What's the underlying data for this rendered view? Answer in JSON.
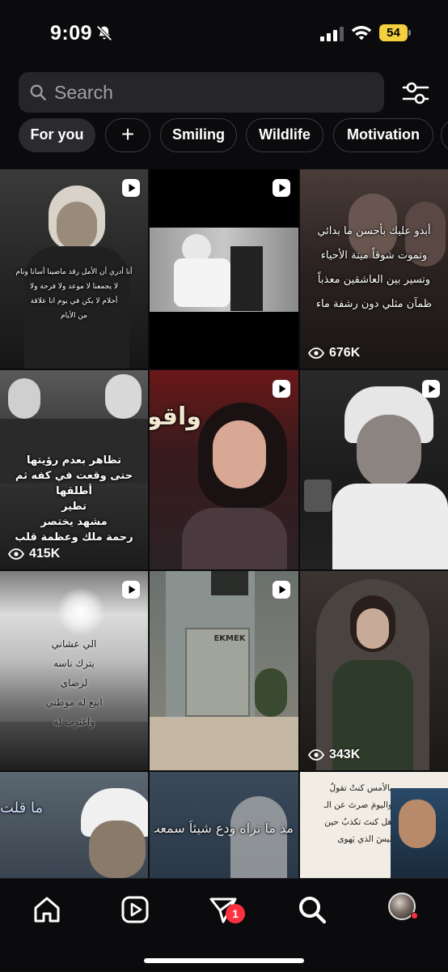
{
  "status_bar": {
    "time": "9:09",
    "battery_level": "54",
    "icons": [
      "bell-slash-icon",
      "signal-icon",
      "wifi-icon",
      "battery-icon"
    ]
  },
  "search": {
    "placeholder": "Search",
    "value": ""
  },
  "chips": [
    {
      "label": "For you",
      "active": true
    },
    {
      "label": "+",
      "active": false
    },
    {
      "label": "Smiling",
      "active": false
    },
    {
      "label": "Wildlife",
      "active": false
    },
    {
      "label": "Motivation",
      "active": false
    }
  ],
  "grid": {
    "tiles": [
      {
        "caption": "أنا أدري أن الأمل رقد ماضينا أسانا ونام\nلا يجمعنا لا موعد ولا فرحة ولا\nأحلام لا يكن في يوم انا علاقة\nمن الأيام",
        "reel": true,
        "views": ""
      },
      {
        "caption": "",
        "reel": true,
        "views": ""
      },
      {
        "caption": "أبدو عليك بأحسن ما بدائي\nوتموت شوقاً ميتة الأحياء\nوتسير بين العاشقين معذباً\nظمآن مثلي دون رشفة ماء",
        "reel": false,
        "views": "676K"
      },
      {
        "caption": "تظاهر بعدم رؤيتها\nحتى وقعت في كفه ثم أطلقها\nتطير\nمشهد يختصر\nرحمة ملك وعظمة قلب",
        "reel": false,
        "views": "415K"
      },
      {
        "caption": "واقو",
        "reel": true,
        "views": ""
      },
      {
        "caption": "",
        "reel": true,
        "views": ""
      },
      {
        "caption": "الي عشاني\nيترك ناسه\nلرضاي\nابيع له موطني\nواغترب له",
        "reel": true,
        "views": ""
      },
      {
        "caption": "EKMEK",
        "reel": true,
        "views": ""
      },
      {
        "caption": "",
        "reel": false,
        "views": "343K"
      },
      {
        "caption": "ما قلت",
        "reel": false,
        "views": ""
      },
      {
        "caption": "مذ ما تراه ودع شيئاً سمعت به",
        "reel": false,
        "views": ""
      },
      {
        "caption": "بالأمس كنتُ تقولُ\nواليومَ صرتَ عن الـ\nهل كنتَ تكذبُ حين\nليسَ الذي يَهوى",
        "reel": false,
        "views": ""
      }
    ]
  },
  "nav": {
    "items": [
      "home-icon",
      "reels-icon",
      "send-icon",
      "search-icon",
      "profile-avatar"
    ],
    "messages_badge": "1"
  },
  "colors": {
    "background": "#0b0b0d",
    "chip_active": "#2a2a2f",
    "search_bg": "#26262a",
    "badge": "#ff3040",
    "battery": "#f4d03f"
  }
}
